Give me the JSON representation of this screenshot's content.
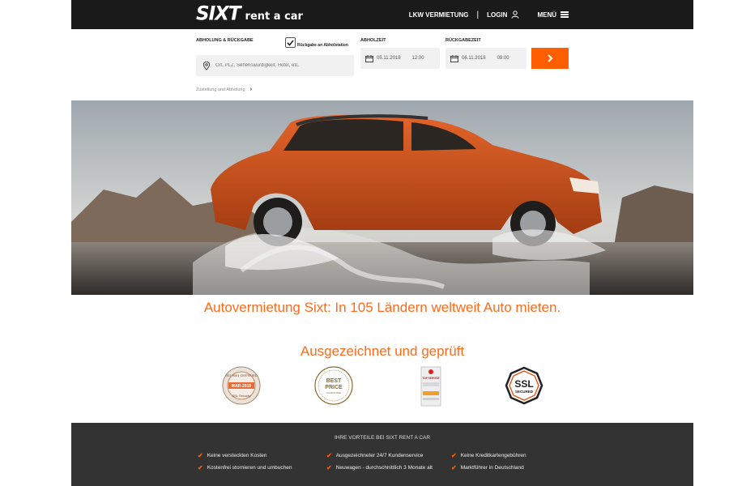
{
  "header": {
    "logo_main": "SIXT",
    "logo_sub": "rent a car",
    "nav_truck": "LKW VERMIETUNG",
    "nav_separator": "|",
    "nav_login": "LOGIN",
    "nav_menu": "MENÜ"
  },
  "booking": {
    "pickup_return_label": "ABHOLUNG & RÜCKGABE",
    "return_same_label": "Rückgabe an Abholstation",
    "return_same_checked": true,
    "location_placeholder": "Ort, PLZ, Sehenswürdigkeit, Hotel, etc.",
    "pickup_time_label": "ABHOLZEIT",
    "pickup_date": "05.11.2018",
    "pickup_time": "12:00",
    "return_time_label": "RÜCKGABEZEIT",
    "return_date": "06.11.2018",
    "return_time": "09:00",
    "delivery_link": "Zustellung und Abholung",
    "accent": "#ff5f00"
  },
  "tagline": "Autovermietung Sixt: In 105 Ländern weltweit Auto mieten.",
  "awards": {
    "title": "Ausgezeichnet und geprüft",
    "badge1_top": "ISO 9001 CERTIFIED",
    "badge1_date": "MAR-2018",
    "badge1_bottom": "SSL Security",
    "badge2_line1": "BEST",
    "badge2_line2": "PRICE",
    "badge2_line3": "GUARANTEE",
    "badge3_text": "TOP SERVICE",
    "badge4_line1": "SSL",
    "badge4_line2": "SECURED"
  },
  "footer": {
    "title": "IHRE VORTEILE BEI SIXT RENT A CAR",
    "benefits": [
      "Keine versteckten Kosten",
      "Ausgezeichneter 24/7 Kundenservice",
      "Keine Kreditkartengebühren",
      "Kostenfrei stornieren und umbuchen",
      "Neuwagen - durchschnittlich 3 Monate alt",
      "Marktführer in Deutschland"
    ]
  }
}
